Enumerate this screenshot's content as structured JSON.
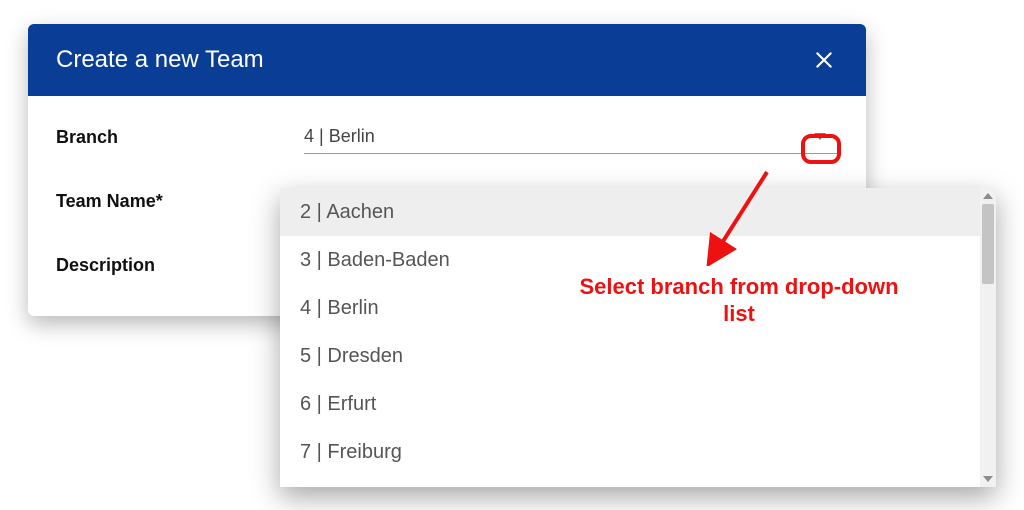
{
  "dialog": {
    "title": "Create a new Team",
    "close_icon_name": "close-icon",
    "fields": {
      "branch_label": "Branch",
      "team_name_label": "Team Name*",
      "description_label": "Description"
    },
    "branch": {
      "selected": "4 | Berlin",
      "options": [
        "2 | Aachen",
        "3 | Baden-Baden",
        "4 | Berlin",
        "5 | Dresden",
        "6 | Erfurt",
        "7 | Freiburg"
      ],
      "hovered_index": 0
    }
  },
  "annotation": {
    "text": "Select branch from drop-down list",
    "color": "#ee1111"
  }
}
